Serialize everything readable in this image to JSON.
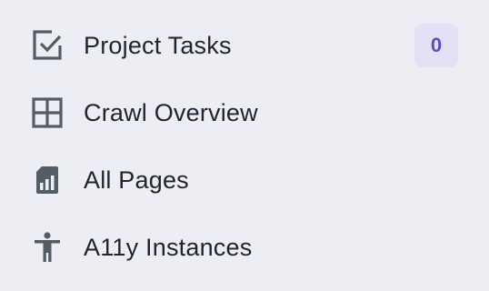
{
  "nav": {
    "items": [
      {
        "label": "Project Tasks",
        "icon": "checkbox-icon",
        "badge": "0"
      },
      {
        "label": "Crawl Overview",
        "icon": "grid-icon"
      },
      {
        "label": "All Pages",
        "icon": "sim-card-chart-icon"
      },
      {
        "label": "A11y Instances",
        "icon": "accessibility-icon"
      }
    ]
  },
  "colors": {
    "background": "#eceef4",
    "text": "#1f2430",
    "icon": "#545c66",
    "badge_bg": "#e4e0f6",
    "badge_text": "#6446c8"
  }
}
